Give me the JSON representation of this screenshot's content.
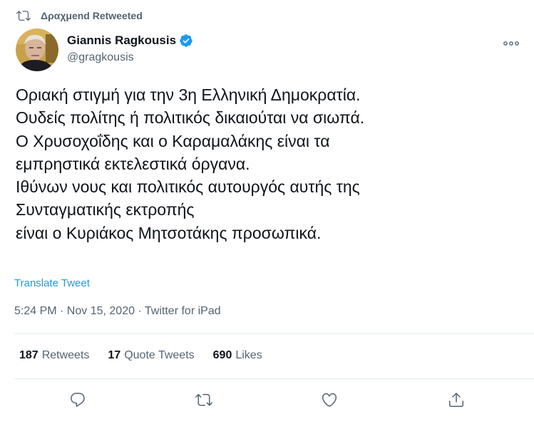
{
  "retweet_context": {
    "text": "Δραχμend Retweeted",
    "icon": "retweet-icon"
  },
  "author": {
    "display_name": "Giannis Ragkousis",
    "handle": "@gragkousis",
    "verified": true,
    "avatar": "avatar",
    "more_icon": "more-icon"
  },
  "tweet": {
    "lines": [
      "Οριακή στιγμή για την 3η Ελληνική Δημοκρατία.",
      "Ουδείς πολίτης ή πολιτικός δικαιούται να σιωπά.",
      "Ο Χρυσοχοΐδης και ο Καραμαλάκης είναι τα",
      "εμπρηστικά εκτελεστικά όργανα.",
      "Ιθύνων νους και πολιτικός αυτουργός αυτής της",
      "Συνταγματικής εκτροπής",
      "είναι ο Κυριάκος Μητσοτάκης προσωπικά."
    ],
    "translate_label": "Translate Tweet",
    "timestamp": "5:24 PM · Nov 15, 2020 · Twitter for iPad"
  },
  "stats": {
    "retweets": {
      "count": "187",
      "label": "Retweets"
    },
    "quotes": {
      "count": "17",
      "label": "Quote Tweets"
    },
    "likes": {
      "count": "690",
      "label": "Likes"
    }
  },
  "actions": [
    {
      "name": "reply",
      "icon": "reply-icon"
    },
    {
      "name": "retweet",
      "icon": "retweet-icon"
    },
    {
      "name": "like",
      "icon": "heart-icon"
    },
    {
      "name": "share",
      "icon": "share-icon"
    }
  ],
  "colors": {
    "accent": "#1d9bf0",
    "secondary_text": "#536471",
    "primary_text": "#0f1419",
    "divider": "#e6ecf0"
  }
}
